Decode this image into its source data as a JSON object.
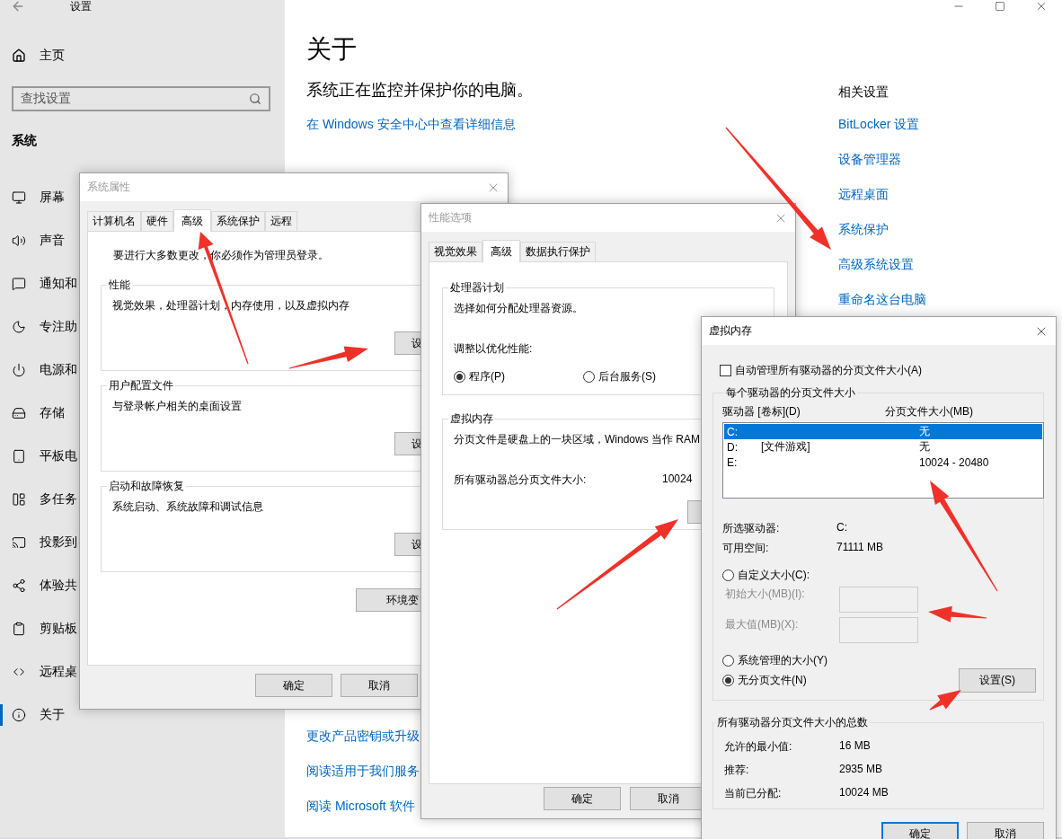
{
  "settings_window": {
    "title": "设置",
    "home": "主页",
    "search": {
      "placeholder": "查找设置"
    },
    "section": "系统",
    "nav": [
      {
        "label": "屏幕",
        "selected": false
      },
      {
        "label": "声音",
        "selected": false
      },
      {
        "label": "通知和",
        "selected": false
      },
      {
        "label": "专注助",
        "selected": false
      },
      {
        "label": "电源和",
        "selected": false
      },
      {
        "label": "存储",
        "selected": false
      },
      {
        "label": "平板电",
        "selected": false
      },
      {
        "label": "多任务",
        "selected": false
      },
      {
        "label": "投影到",
        "selected": false
      },
      {
        "label": "体验共",
        "selected": false
      },
      {
        "label": "剪贴板",
        "selected": false
      },
      {
        "label": "远程桌",
        "selected": false
      },
      {
        "label": "关于",
        "selected": true
      }
    ],
    "page": {
      "heading": "关于",
      "status": "系统正在监控并保护你的电脑。",
      "security_link": "在 Windows 安全中心中查看详细信息",
      "bottom_links": [
        "更改产品密钥或升级",
        "阅读适用于我们服务",
        "阅读 Microsoft 软件"
      ]
    },
    "related": {
      "title": "相关设置",
      "links": [
        "BitLocker 设置",
        "设备管理器",
        "远程桌面",
        "系统保护",
        "高级系统设置",
        "重命名这台电脑"
      ]
    }
  },
  "system_properties": {
    "title": "系统属性",
    "tabs": [
      {
        "label": "计算机名",
        "selected": false
      },
      {
        "label": "硬件",
        "selected": false
      },
      {
        "label": "高级",
        "selected": true
      },
      {
        "label": "系统保护",
        "selected": false
      },
      {
        "label": "远程",
        "selected": false
      }
    ],
    "notice": "要进行大多数更改，你必须作为管理员登录。",
    "groups": [
      {
        "title": "性能",
        "text": "视觉效果，处理器计划，内存使用，以及虚拟内存",
        "button": "设"
      },
      {
        "title": "用户配置文件",
        "text": "与登录帐户相关的桌面设置",
        "button": "设"
      },
      {
        "title": "启动和故障恢复",
        "text": "系统启动、系统故障和调试信息",
        "button": "设"
      }
    ],
    "env_button": "环境变",
    "buttons": [
      "确定",
      "取消"
    ]
  },
  "performance_options": {
    "title": "性能选项",
    "tabs": [
      {
        "label": "视觉效果",
        "selected": false
      },
      {
        "label": "高级",
        "selected": true
      },
      {
        "label": "数据执行保护",
        "selected": false
      }
    ],
    "scheduling": {
      "title": "处理器计划",
      "text": "选择如何分配处理器资源。",
      "prompt": "调整以优化性能:",
      "options": [
        {
          "label": "程序(P)",
          "selected": true
        },
        {
          "label": "后台服务(S)",
          "selected": false
        }
      ]
    },
    "virtual_memory": {
      "title": "虚拟内存",
      "text": "分页文件是硬盘上的一块区域，Windows 当作 RAM",
      "total_label": "所有驱动器总分页文件大小:",
      "total_value": "10024"
    },
    "buttons": [
      "确定",
      "取消"
    ]
  },
  "virtual_memory_dialog": {
    "title": "虚拟内存",
    "auto_manage": {
      "label": "自动管理所有驱动器的分页文件大小(A)",
      "checked": false
    },
    "per_drive": {
      "title": "每个驱动器的分页文件大小",
      "columns": [
        "驱动器 [卷标](D)",
        "分页文件大小(MB)"
      ],
      "drives": [
        {
          "drive": "C:",
          "size": "无",
          "selected": true
        },
        {
          "drive": "D:",
          "volume": "[文件游戏]",
          "size": "无",
          "selected": false
        },
        {
          "drive": "E:",
          "size": "10024 - 20480",
          "selected": false
        }
      ],
      "selected_drive": {
        "label": "所选驱动器:",
        "value": "C:"
      },
      "free_space": {
        "label": "可用空间:",
        "value": "71111 MB"
      },
      "custom": {
        "label": "自定义大小(C):",
        "selected": false
      },
      "fields": [
        {
          "label": "初始大小(MB)(I):",
          "disabled": true
        },
        {
          "label": "最大值(MB)(X):",
          "disabled": true
        }
      ],
      "system_managed": {
        "label": "系统管理的大小(Y)",
        "selected": false
      },
      "no_paging": {
        "label": "无分页文件(N)",
        "selected": true
      },
      "set_button": "设置(S)"
    },
    "totals": {
      "title": "所有驱动器分页文件大小的总数",
      "rows": [
        {
          "label": "允许的最小值:",
          "value": "16 MB"
        },
        {
          "label": "推荐:",
          "value": "2935 MB"
        },
        {
          "label": "当前已分配:",
          "value": "10024 MB"
        }
      ]
    },
    "buttons": [
      {
        "label": "确定",
        "default": true
      },
      {
        "label": "取消",
        "default": false
      }
    ]
  }
}
